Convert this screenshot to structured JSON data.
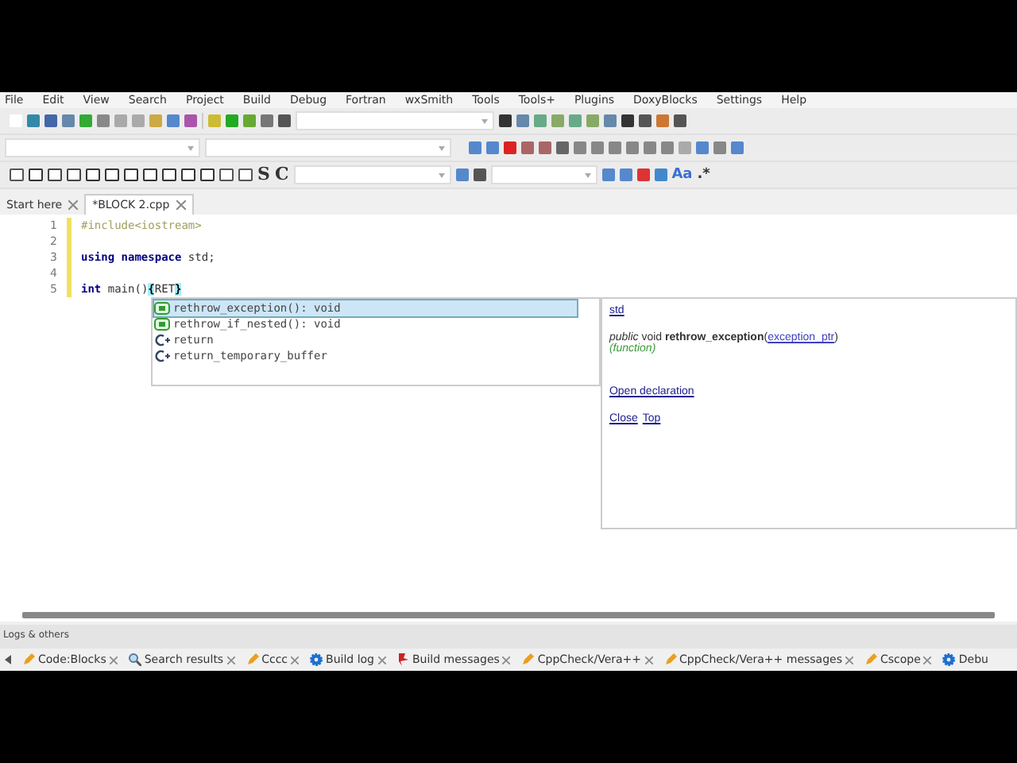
{
  "menu": [
    "File",
    "Edit",
    "View",
    "Search",
    "Project",
    "Build",
    "Debug",
    "Fortran",
    "wxSmith",
    "Tools",
    "Tools+",
    "Plugins",
    "DoxyBlocks",
    "Settings",
    "Help"
  ],
  "toolbar_glyphs": [
    "S",
    "C",
    "Aa",
    ".*"
  ],
  "editor_tabs": [
    {
      "label": "Start here",
      "selected": false
    },
    {
      "label": "*BLOCK 2.cpp",
      "selected": true
    }
  ],
  "lines": [
    {
      "number": "1",
      "modified": true,
      "tokens": [
        {
          "kind": "preproc",
          "text": "#include<iostream>"
        }
      ]
    },
    {
      "number": "2",
      "modified": true
    },
    {
      "number": "3",
      "modified": true,
      "tokens": [
        {
          "kind": "keyword",
          "text": "using namespace"
        },
        {
          "kind": "plain",
          "text": " std;"
        }
      ]
    },
    {
      "number": "4",
      "modified": true
    },
    {
      "number": "5",
      "modified": true,
      "tokens": [
        {
          "kind": "keyword",
          "text": "int"
        },
        {
          "kind": "plain",
          "text": " main()"
        },
        {
          "kind": "brace",
          "text": "{"
        },
        {
          "kind": "plain",
          "text": "RET"
        },
        {
          "kind": "brace",
          "text": "}"
        }
      ]
    }
  ],
  "completions": [
    {
      "kind": "function",
      "label": "rethrow_exception(): void",
      "selected": true
    },
    {
      "kind": "function",
      "label": "rethrow_if_nested(): void",
      "selected": false
    },
    {
      "kind": "keyword",
      "label": "return",
      "selected": false
    },
    {
      "kind": "keyword",
      "label": "return_temporary_buffer",
      "selected": false
    }
  ],
  "doc": {
    "scope": "std",
    "signature": "*public* void **rethrow_exception**(",
    "param": "exception_ptr",
    "signature_end": ")",
    "kind": "(function)",
    "open_link": "Open declaration",
    "close_link": "Close",
    "top_link": "Top"
  },
  "logs_title": "Logs & others",
  "log_tabs": [
    {
      "kind": "tool",
      "label": "Code:Blocks"
    },
    {
      "kind": "search",
      "label": "Search results"
    },
    {
      "kind": "tool",
      "label": "Cccc"
    },
    {
      "kind": "build",
      "label": "Build log"
    },
    {
      "kind": "messages",
      "label": "Build messages"
    },
    {
      "kind": "tool",
      "label": "CppCheck/Vera++"
    },
    {
      "kind": "tool",
      "label": "CppCheck/Vera++ messages"
    },
    {
      "kind": "tool",
      "label": "Cscope"
    },
    {
      "kind": "build",
      "label": "Debu"
    }
  ]
}
